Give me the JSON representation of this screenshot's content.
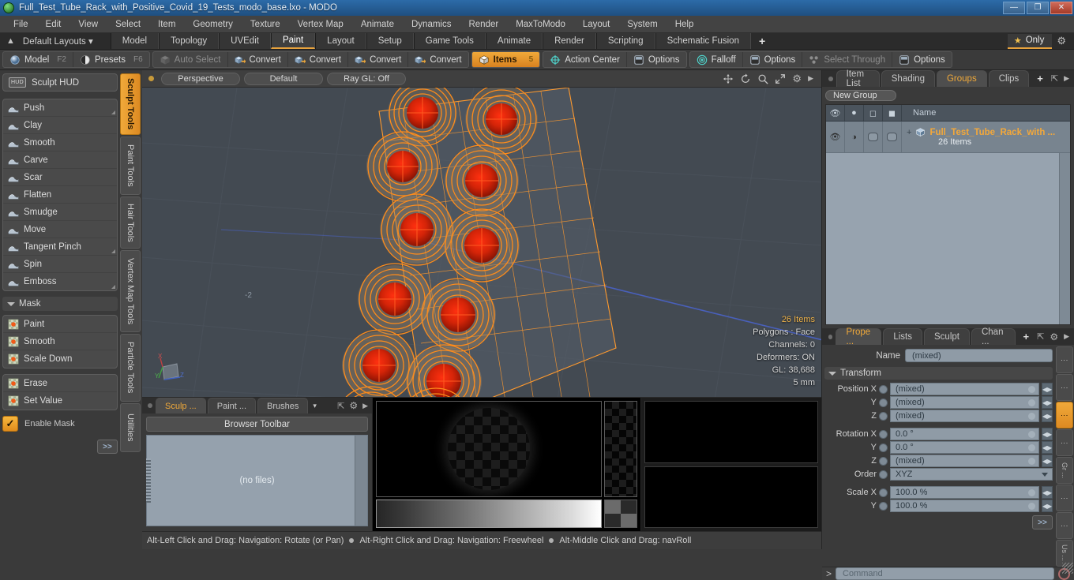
{
  "titlebar": {
    "title": "Full_Test_Tube_Rack_with_Positive_Covid_19_Tests_modo_base.lxo - MODO",
    "minimize": "—",
    "maximize": "❐",
    "close": "✕"
  },
  "menubar": {
    "items": [
      "File",
      "Edit",
      "View",
      "Select",
      "Item",
      "Geometry",
      "Texture",
      "Vertex Map",
      "Animate",
      "Dynamics",
      "Render",
      "MaxToModo",
      "Layout",
      "System",
      "Help"
    ]
  },
  "layout_row": {
    "layouts_label": "Default Layouts",
    "tabs": [
      {
        "label": "Model",
        "active": false
      },
      {
        "label": "Topology",
        "active": false
      },
      {
        "label": "UVEdit",
        "active": false
      },
      {
        "label": "Paint",
        "active": true
      },
      {
        "label": "Layout",
        "active": false
      },
      {
        "label": "Setup",
        "active": false
      },
      {
        "label": "Game Tools",
        "active": false
      },
      {
        "label": "Animate",
        "active": false
      },
      {
        "label": "Render",
        "active": false
      },
      {
        "label": "Scripting",
        "active": false
      },
      {
        "label": "Schematic Fusion",
        "active": false
      }
    ],
    "add_tab": "+",
    "only_label": "Only"
  },
  "toolbar": {
    "group1": [
      {
        "label": "Model",
        "hotkey": "F2",
        "icon": "sphere-icon"
      },
      {
        "label": "Presets",
        "hotkey": "F6",
        "icon": "presets-icon"
      }
    ],
    "group2": [
      {
        "label": "Auto Select",
        "dim": true,
        "icon": "cube-icon"
      },
      {
        "label": "Convert",
        "dim": false,
        "icon": "convert-icon"
      },
      {
        "label": "Convert",
        "dim": false,
        "icon": "convert-icon"
      },
      {
        "label": "Convert",
        "dim": false,
        "icon": "convert-icon"
      },
      {
        "label": "Convert",
        "dim": false,
        "icon": "convert-icon"
      }
    ],
    "items_button": {
      "label": "Items",
      "badge": "5",
      "icon": "items-cube-icon"
    },
    "group3": [
      {
        "label": "Action Center",
        "icon": "action-center-icon"
      },
      {
        "label": "Options",
        "icon": "options-square-icon"
      }
    ],
    "group4": [
      {
        "label": "Falloff",
        "icon": "falloff-icon"
      },
      {
        "label": "Options",
        "icon": "options-square-icon"
      },
      {
        "label": "Select Through",
        "dim": true,
        "icon": "select-through-icon"
      },
      {
        "label": "Options",
        "icon": "options-square-icon"
      }
    ]
  },
  "sidebar": {
    "hud": {
      "label": "Sculpt HUD",
      "badge": "HUD"
    },
    "sculpt_tools": [
      {
        "label": "Push",
        "corner": true
      },
      {
        "label": "Clay",
        "corner": false
      },
      {
        "label": "Smooth",
        "corner": false
      },
      {
        "label": "Carve",
        "corner": false
      },
      {
        "label": "Scar",
        "corner": false
      },
      {
        "label": "Flatten",
        "corner": false
      },
      {
        "label": "Smudge",
        "corner": false
      },
      {
        "label": "Move",
        "corner": false
      },
      {
        "label": "Tangent Pinch",
        "corner": true
      },
      {
        "label": "Spin",
        "corner": false
      },
      {
        "label": "Emboss",
        "corner": true
      }
    ],
    "mask_header": "Mask",
    "mask_tools": [
      "Paint",
      "Smooth",
      "Scale Down"
    ],
    "mask_tools2": [
      "Erase",
      "Set Value"
    ],
    "enable_mask": "Enable Mask",
    "expand": ">>",
    "vertical_tabs": [
      {
        "label": "Sculpt Tools",
        "active": true
      },
      {
        "label": "Paint Tools",
        "active": false
      },
      {
        "label": "Hair Tools",
        "active": false
      },
      {
        "label": "Vertex Map Tools",
        "active": false
      },
      {
        "label": "Particle Tools",
        "active": false
      },
      {
        "label": "Utilities",
        "active": false
      }
    ]
  },
  "viewport": {
    "header": {
      "view_mode": "Perspective",
      "shading": "Default",
      "raygl": "Ray GL: Off"
    },
    "nav_icons": [
      "move-icon",
      "rotate-icon",
      "zoom-icon",
      "fit-icon",
      "gear-icon",
      "arrow-icon"
    ],
    "stats": {
      "items": "26 Items",
      "polygons": "Polygons : Face",
      "channels": "Channels: 0",
      "deformers": "Deformers: ON",
      "gl": "GL: 38,688",
      "scale": "5 mm"
    },
    "grid_label": "-2",
    "axes": {
      "x": "X",
      "y": "Y",
      "z": "Z"
    }
  },
  "browser": {
    "tabs": [
      {
        "label": "Sculp ...",
        "active": true
      },
      {
        "label": "Paint ...",
        "active": false
      },
      {
        "label": "Brushes",
        "active": false
      }
    ],
    "toolbar_label": "Browser Toolbar",
    "empty_label": "(no files)"
  },
  "right_panel": {
    "tabs": [
      {
        "label": "Item List",
        "active": false
      },
      {
        "label": "Shading",
        "active": false
      },
      {
        "label": "Groups",
        "active": true
      },
      {
        "label": "Clips",
        "active": false
      }
    ],
    "add_tab": "+",
    "new_group_button": "New Group",
    "list_header": {
      "col_eye": "eye-icon",
      "col_render": "render-icon",
      "col_box1": "box-outline-icon",
      "col_box2": "box-solid-icon",
      "name": "Name"
    },
    "rows": [
      {
        "title": "Full_Test_Tube_Rack_with ...",
        "subtitle": "26 Items",
        "expander": "+"
      }
    ]
  },
  "properties": {
    "tabs": [
      {
        "label": "Prope ...",
        "active": true
      },
      {
        "label": "Lists",
        "active": false
      },
      {
        "label": "Sculpt",
        "active": false
      },
      {
        "label": "Chan ...",
        "active": false
      }
    ],
    "add_tab": "+",
    "name_label": "Name",
    "name_value": "(mixed)",
    "transform_header": "Transform",
    "fields": [
      {
        "label": "Position X",
        "value": "(mixed)",
        "type": "num"
      },
      {
        "label": "Y",
        "value": "(mixed)",
        "type": "num"
      },
      {
        "label": "Z",
        "value": "(mixed)",
        "type": "num"
      },
      {
        "label": "Rotation X",
        "value": "0.0 °",
        "type": "num"
      },
      {
        "label": "Y",
        "value": "0.0 °",
        "type": "num"
      },
      {
        "label": "Z",
        "value": "(mixed)",
        "type": "num"
      },
      {
        "label": "Order",
        "value": "XYZ",
        "type": "select"
      },
      {
        "label": "Scale X",
        "value": "100.0 %",
        "type": "num"
      },
      {
        "label": "Y",
        "value": "100.0 %",
        "type": "num"
      }
    ],
    "expand": ">>",
    "side_tabs": [
      "⋮",
      "⋮",
      "⋮",
      "⋮",
      "Gr ...",
      "⋮",
      "⋮",
      "Us ..."
    ]
  },
  "statusbar": {
    "hints": [
      "Alt-Left Click and Drag: Navigation: Rotate (or Pan)",
      "Alt-Right Click and Drag: Navigation: Freewheel",
      "Alt-Middle Click and Drag: navRoll"
    ]
  },
  "command": {
    "prompt": ">",
    "placeholder": "Command"
  }
}
